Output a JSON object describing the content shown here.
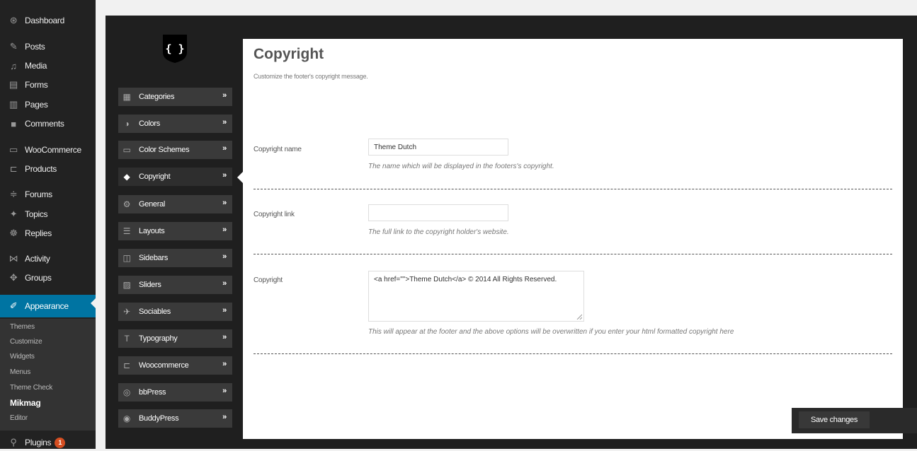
{
  "sidebar": {
    "items": [
      {
        "label": "Dashboard",
        "icon": "dashboard-icon"
      },
      {
        "label": "Posts",
        "icon": "pin-icon"
      },
      {
        "label": "Media",
        "icon": "media-icon"
      },
      {
        "label": "Forms",
        "icon": "forms-icon"
      },
      {
        "label": "Pages",
        "icon": "pages-icon"
      },
      {
        "label": "Comments",
        "icon": "comments-icon"
      },
      {
        "label": "WooCommerce",
        "icon": "woocommerce-icon"
      },
      {
        "label": "Products",
        "icon": "cart-icon"
      },
      {
        "label": "Forums",
        "icon": "forums-icon"
      },
      {
        "label": "Topics",
        "icon": "topics-icon"
      },
      {
        "label": "Replies",
        "icon": "replies-icon"
      },
      {
        "label": "Activity",
        "icon": "activity-icon"
      },
      {
        "label": "Groups",
        "icon": "groups-icon"
      },
      {
        "label": "Appearance",
        "icon": "appearance-icon"
      },
      {
        "label": "Plugins",
        "icon": "plugins-icon",
        "badge": "1"
      }
    ],
    "submenu": [
      "Themes",
      "Customize",
      "Widgets",
      "Menus",
      "Theme Check",
      "Mikmag",
      "Editor"
    ],
    "accent": "#0074a2"
  },
  "options": {
    "logo_text": "{ }",
    "tabs": [
      {
        "label": "Categories",
        "icon": "grid-icon"
      },
      {
        "label": "Colors",
        "icon": "contrast-icon"
      },
      {
        "label": "Color Schemes",
        "icon": "monitor-icon"
      },
      {
        "label": "Copyright",
        "icon": "tag-icon"
      },
      {
        "label": "General",
        "icon": "cogs-icon"
      },
      {
        "label": "Layouts",
        "icon": "list-icon"
      },
      {
        "label": "Sidebars",
        "icon": "columns-icon"
      },
      {
        "label": "Sliders",
        "icon": "image-icon"
      },
      {
        "label": "Sociables",
        "icon": "twitter-icon"
      },
      {
        "label": "Typography",
        "icon": "typography-icon"
      },
      {
        "label": "Woocommerce",
        "icon": "cart-icon"
      },
      {
        "label": "bbPress",
        "icon": "bbpress-icon"
      },
      {
        "label": "BuddyPress",
        "icon": "buddypress-icon"
      }
    ],
    "arrow": "»",
    "active_tab": "Copyright"
  },
  "content": {
    "title": "Copyright",
    "description": "Customize the footer's copyright message.",
    "fields": [
      {
        "label": "Copyright name",
        "value": "Theme Dutch",
        "placeholder": "",
        "help": "The name which will be displayed in the footers's copyright."
      },
      {
        "label": "Copyright link",
        "value": "",
        "placeholder": "",
        "help": "The full link to the copyright holder's website."
      },
      {
        "label": "Copyright",
        "value": "<a href=\"\">Theme Dutch</a> © 2014 All Rights Reserved.",
        "placeholder": "",
        "help": "This will appear at the footer and the above options will be overwritten if you enter your html formatted copyright here"
      }
    ]
  },
  "save_button": {
    "label": "Save changes"
  }
}
